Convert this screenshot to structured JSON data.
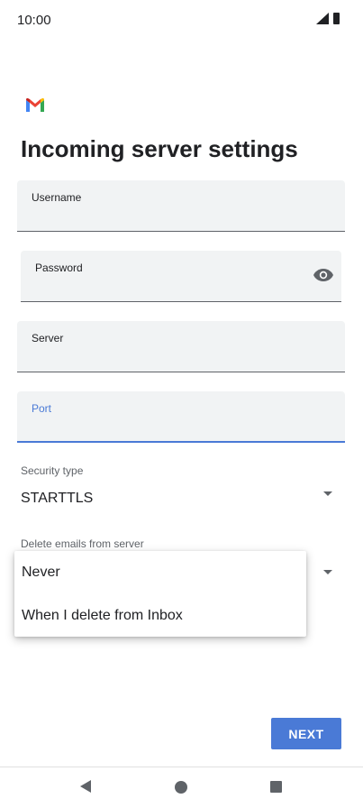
{
  "status_bar": {
    "time": "10:00"
  },
  "app": {
    "logo": "gmail-logo"
  },
  "page": {
    "title": "Incoming server settings"
  },
  "fields": {
    "username": {
      "label": "Username",
      "value": ""
    },
    "password": {
      "label": "Password",
      "value": ""
    },
    "server": {
      "label": "Server",
      "value": ""
    },
    "port": {
      "label": "Port",
      "value": ""
    }
  },
  "security_type": {
    "label": "Security type",
    "value": "STARTTLS"
  },
  "delete_emails": {
    "label": "Delete emails from server",
    "options": [
      "Never",
      "When I delete from Inbox"
    ]
  },
  "actions": {
    "next_label": "NEXT"
  },
  "colors": {
    "accent": "#4a7ad6",
    "field_bg": "#f1f3f4",
    "text": "#202124"
  },
  "icons": {
    "password_toggle": "eye-icon",
    "dropdown": "caret-down-icon"
  }
}
